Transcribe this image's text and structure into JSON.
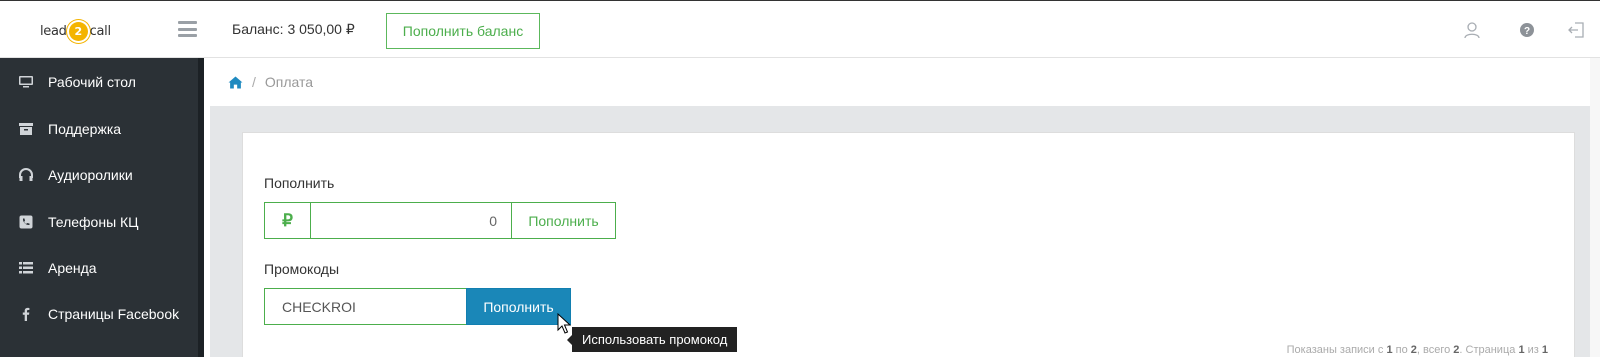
{
  "header": {
    "logo_left": "lead",
    "logo_mid": "2",
    "logo_right": "call",
    "balance_label": "Баланс: 3 050,00 ₽",
    "topup_button": "Пополнить баланс",
    "icons": [
      "hamburger-icon",
      "user-icon",
      "help-icon",
      "logout-icon"
    ]
  },
  "sidebar": {
    "items": [
      {
        "label": "Рабочий стол",
        "icon": "monitor-icon"
      },
      {
        "label": "Поддержка",
        "icon": "archive-icon"
      },
      {
        "label": "Аудиоролики",
        "icon": "headphones-icon"
      },
      {
        "label": "Телефоны КЦ",
        "icon": "phone-square-icon"
      },
      {
        "label": "Аренда",
        "icon": "list-icon"
      },
      {
        "label": "Страницы Facebook",
        "icon": "facebook-icon"
      }
    ]
  },
  "breadcrumb": {
    "home_icon": "home-icon",
    "separator": "/",
    "current": "Оплата"
  },
  "topup": {
    "label": "Пополнить",
    "currency_symbol": "₽",
    "amount_value": "0",
    "button": "Пополнить"
  },
  "promo": {
    "label": "Промокоды",
    "code_value": "CHECKROI",
    "button": "Пополнить",
    "tooltip": "Использовать промокод"
  },
  "pager": {
    "prefix": "Показаны записи с ",
    "from": "1",
    "to_word": " по ",
    "to": "2",
    "total_word": ", всего ",
    "total": "2",
    "page_word": ". Страница ",
    "page": "1",
    "of_word": " из ",
    "pages": "1"
  },
  "colors": {
    "accent_green": "#4cae4c",
    "accent_blue": "#1a87b8",
    "sidebar_bg": "#2b3136",
    "link_blue": "#1f8ac0"
  }
}
